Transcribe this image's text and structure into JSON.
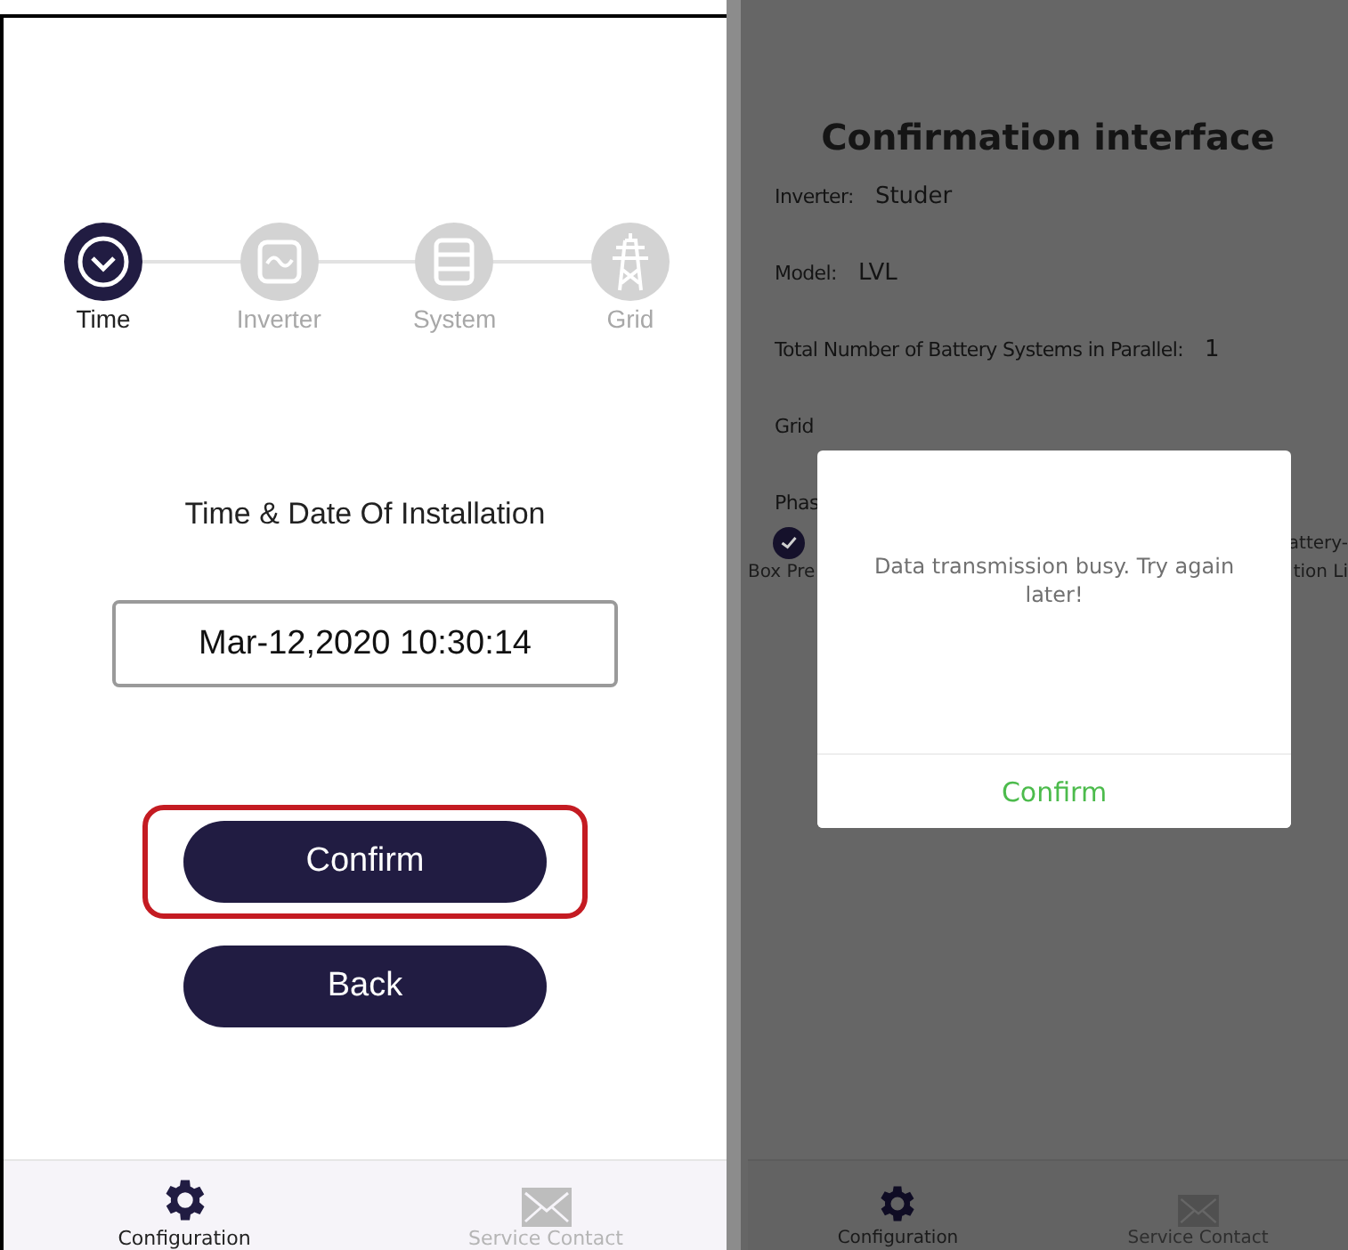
{
  "setup_screen": {
    "steps": [
      {
        "label": "Time",
        "selected": true
      },
      {
        "label": "Inverter",
        "selected": false
      },
      {
        "label": "System",
        "selected": false
      },
      {
        "label": "Grid",
        "selected": false
      }
    ],
    "heading": "Time & Date Of Installation",
    "datetime_value": "Mar-12,2020 10:30:14",
    "buttons": [
      {
        "label": "Confirm",
        "highlighted": true
      },
      {
        "label": "Back",
        "highlighted": false
      }
    ],
    "bottom_nav": [
      {
        "label": "Configuration",
        "selected": true
      },
      {
        "label": "Service Contact",
        "selected": false
      }
    ]
  },
  "confirmation_screen": {
    "title": "Confirmation interface",
    "rows": [
      {
        "label": "Inverter:",
        "value": "Studer"
      },
      {
        "label": "Model:",
        "value": "LVL"
      },
      {
        "label": "Total Number of Battery Systems in Parallel:",
        "value": "1"
      },
      {
        "label": "Grid"
      },
      {
        "label": "Phas"
      }
    ],
    "checkbox": {
      "checked": true,
      "text_right": "attery-",
      "second_line_left": "Box Pre",
      "second_line_right": "tion Li"
    },
    "bottom_nav": [
      {
        "label": "Configuration",
        "selected": true
      },
      {
        "label": "Service Contact",
        "selected": false
      }
    ],
    "dialog": {
      "message": "Data transmission busy. Try again later!",
      "button": "Confirm"
    }
  }
}
